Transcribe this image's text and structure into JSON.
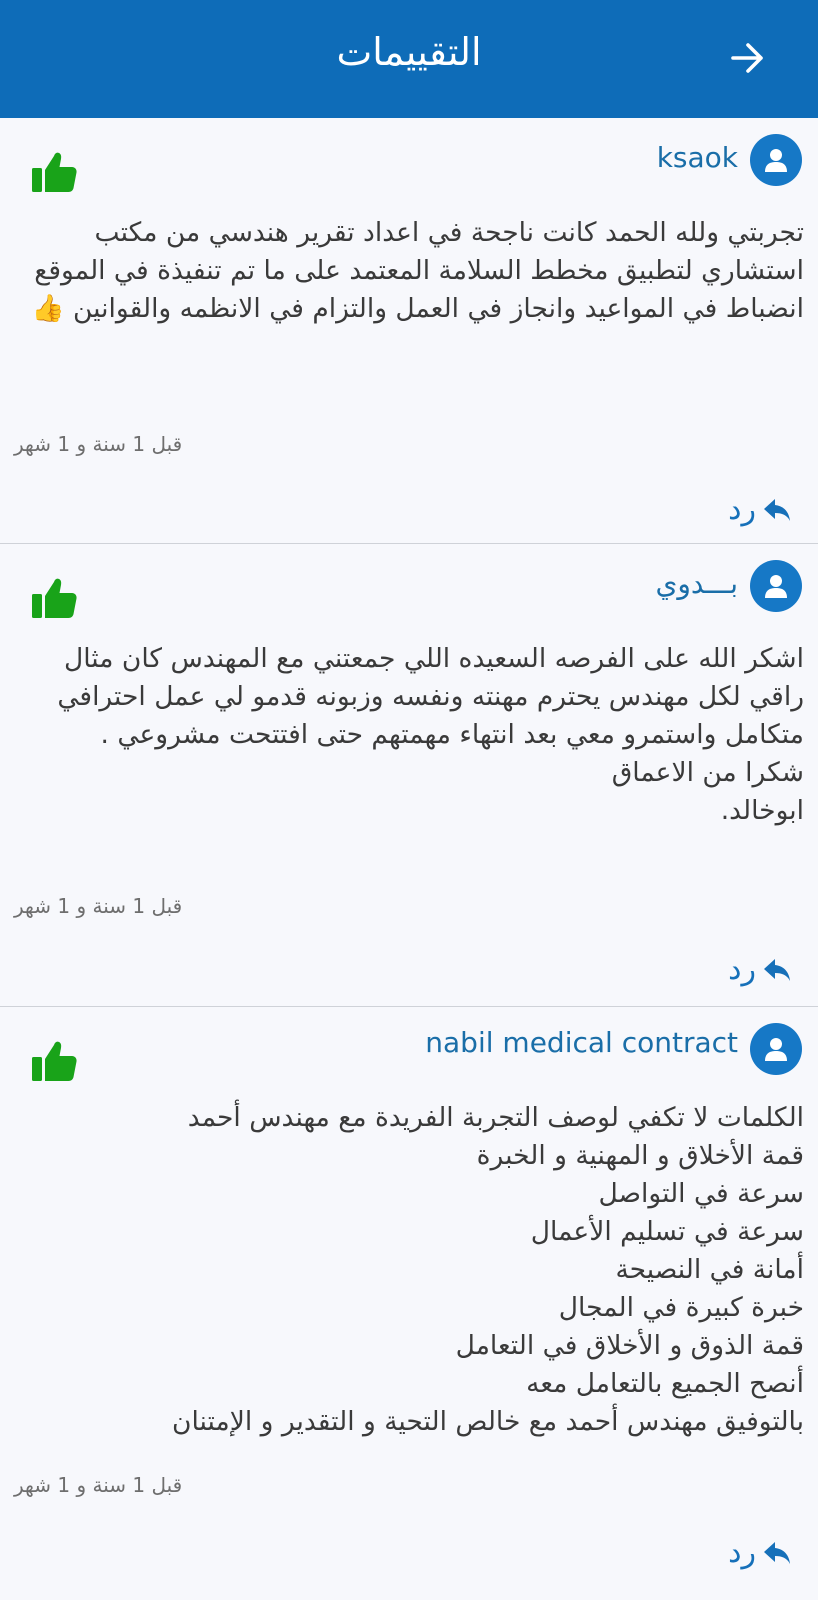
{
  "app_bar": {
    "title": "التقييمات",
    "back_icon": "arrow-right-icon"
  },
  "colors": {
    "header": "#0e6cb8",
    "author": "#1a6ea8",
    "like": "#19a319",
    "reply": "#1670b9"
  },
  "reviews": [
    {
      "author": "ksaok",
      "body": "تجربتي ولله الحمد كانت ناجحة في اعداد تقرير هندسي من مكتب استشاري لتطبيق مخطط السلامة المعتمد على ما تم تنفيذة في الموقع\nانضباط في المواعيد وانجاز في العمل والتزام في الانظمه والقوانين 👍",
      "time": "قبل 1 سنة و 1 شهر",
      "reply_label": "رد"
    },
    {
      "author": "بـــدوي",
      "body": "اشكر الله على الفرصه السعيده اللي جمعتني مع المهندس كان مثال راقي لكل مهندس يحترم مهنته ونفسه وزبونه قدمو لي عمل احترافي متكامل واستمرو معي بعد انتهاء مهمتهم حتى افتتحت مشروعي .\nشكرا من الاعماق\nابوخالد.",
      "time": "قبل 1 سنة و 1 شهر",
      "reply_label": "رد"
    },
    {
      "author": "nabil medical contract",
      "body": "الكلمات لا تكفي لوصف التجربة الفريدة مع مهندس أحمد\nقمة الأخلاق و المهنية و الخبرة\nسرعة في التواصل\nسرعة في تسليم الأعمال\nأمانة في النصيحة\nخبرة كبيرة في المجال\nقمة الذوق و الأخلاق في التعامل\nأنصح الجميع بالتعامل معه\nبالتوفيق مهندس أحمد مع خالص التحية و التقدير و الإمتنان",
      "time": "قبل 1 سنة و 1 شهر",
      "reply_label": "رد"
    }
  ]
}
